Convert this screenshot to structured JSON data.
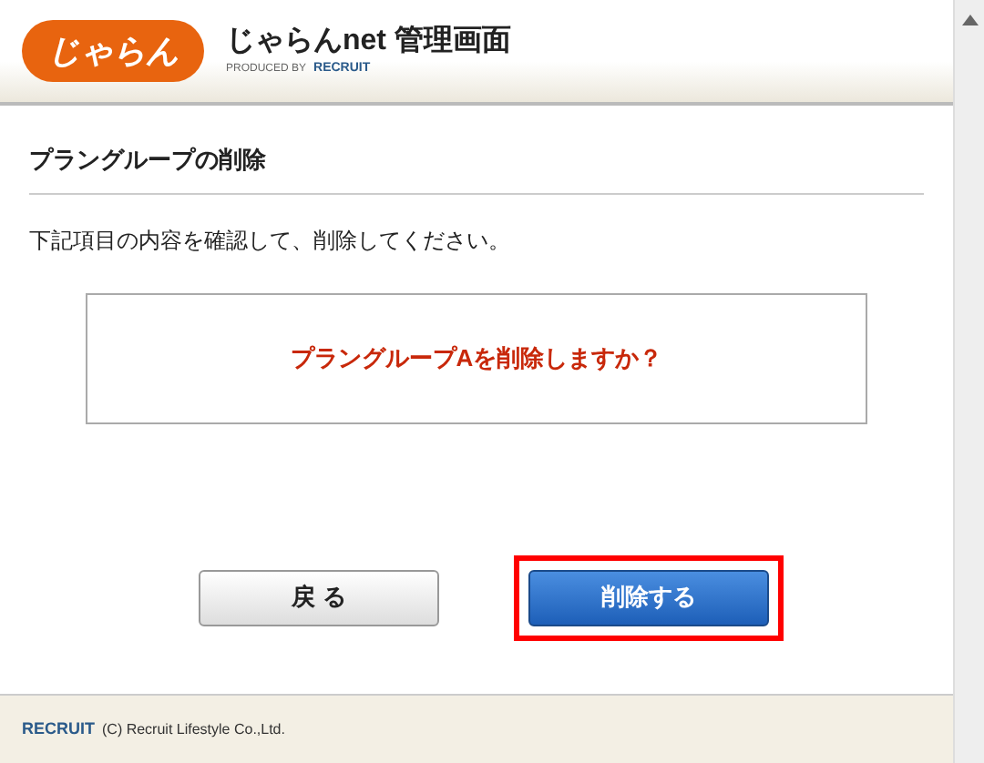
{
  "header": {
    "logo": "じゃらん",
    "title": "じゃらんnet 管理画面",
    "produced_by": "PRODUCED BY",
    "brand": "RECRUIT"
  },
  "page_title": "プラングループの削除",
  "instruction": "下記項目の内容を確認して、削除してください。",
  "confirm_message": "プラングループAを削除しますか？",
  "buttons": [
    {
      "kind": "secondary",
      "label": "戻 る",
      "highlighted": false
    },
    {
      "kind": "primary",
      "label": "削除する",
      "highlighted": true
    }
  ],
  "footer": {
    "brand": "RECRUIT",
    "copyright": "(C) Recruit Lifestyle Co.,Ltd."
  }
}
